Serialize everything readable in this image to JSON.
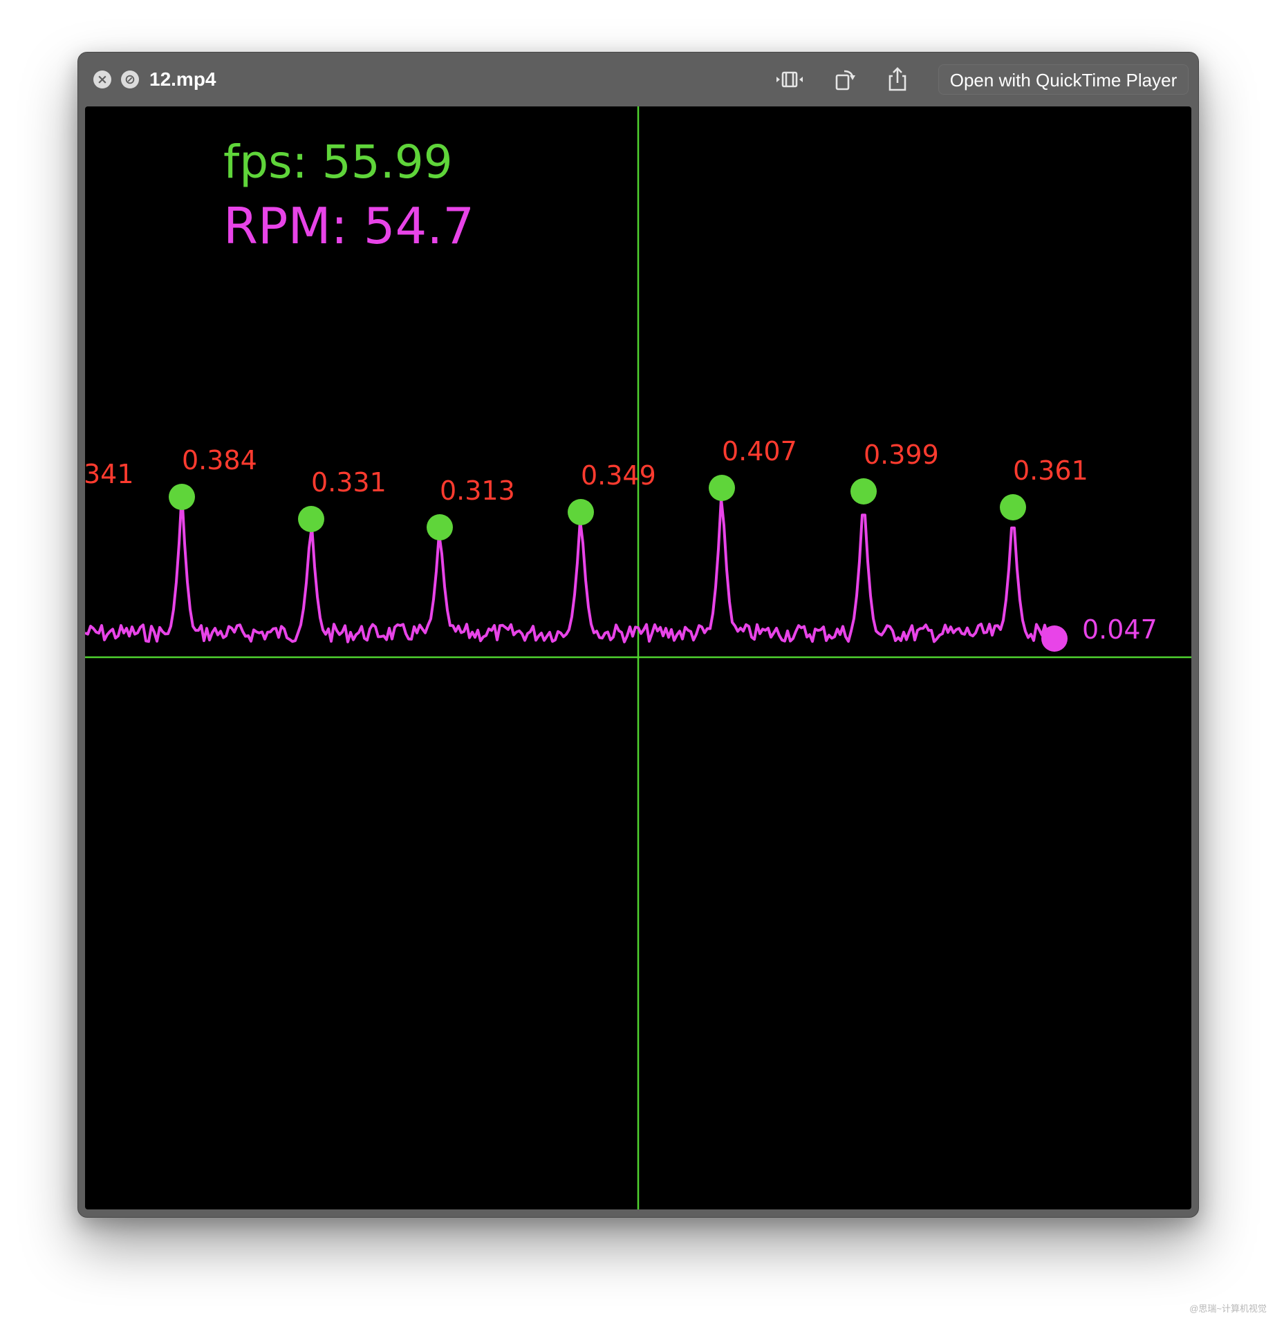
{
  "window": {
    "title": "12.mp4",
    "open_button_label": "Open with QuickTime Player",
    "icons": [
      "close-icon",
      "no-entry-icon",
      "trim-icon",
      "rotate-icon",
      "share-icon"
    ]
  },
  "video": {
    "fps_text": "fps: 55.99",
    "rpm_text": "RPM: 54.7",
    "colors": {
      "background": "#000000",
      "axis": "#4fd12f",
      "signal": "#e844e8",
      "peak_marker": "#5fd53a",
      "peak_label": "#ff3b2f"
    },
    "peak_labels": [
      "341",
      "0.384",
      "0.331",
      "0.313",
      "0.349",
      "0.407",
      "0.399",
      "0.361"
    ],
    "current_value_label": "0.047"
  },
  "watermark": "@思瑞~计算机视觉"
}
